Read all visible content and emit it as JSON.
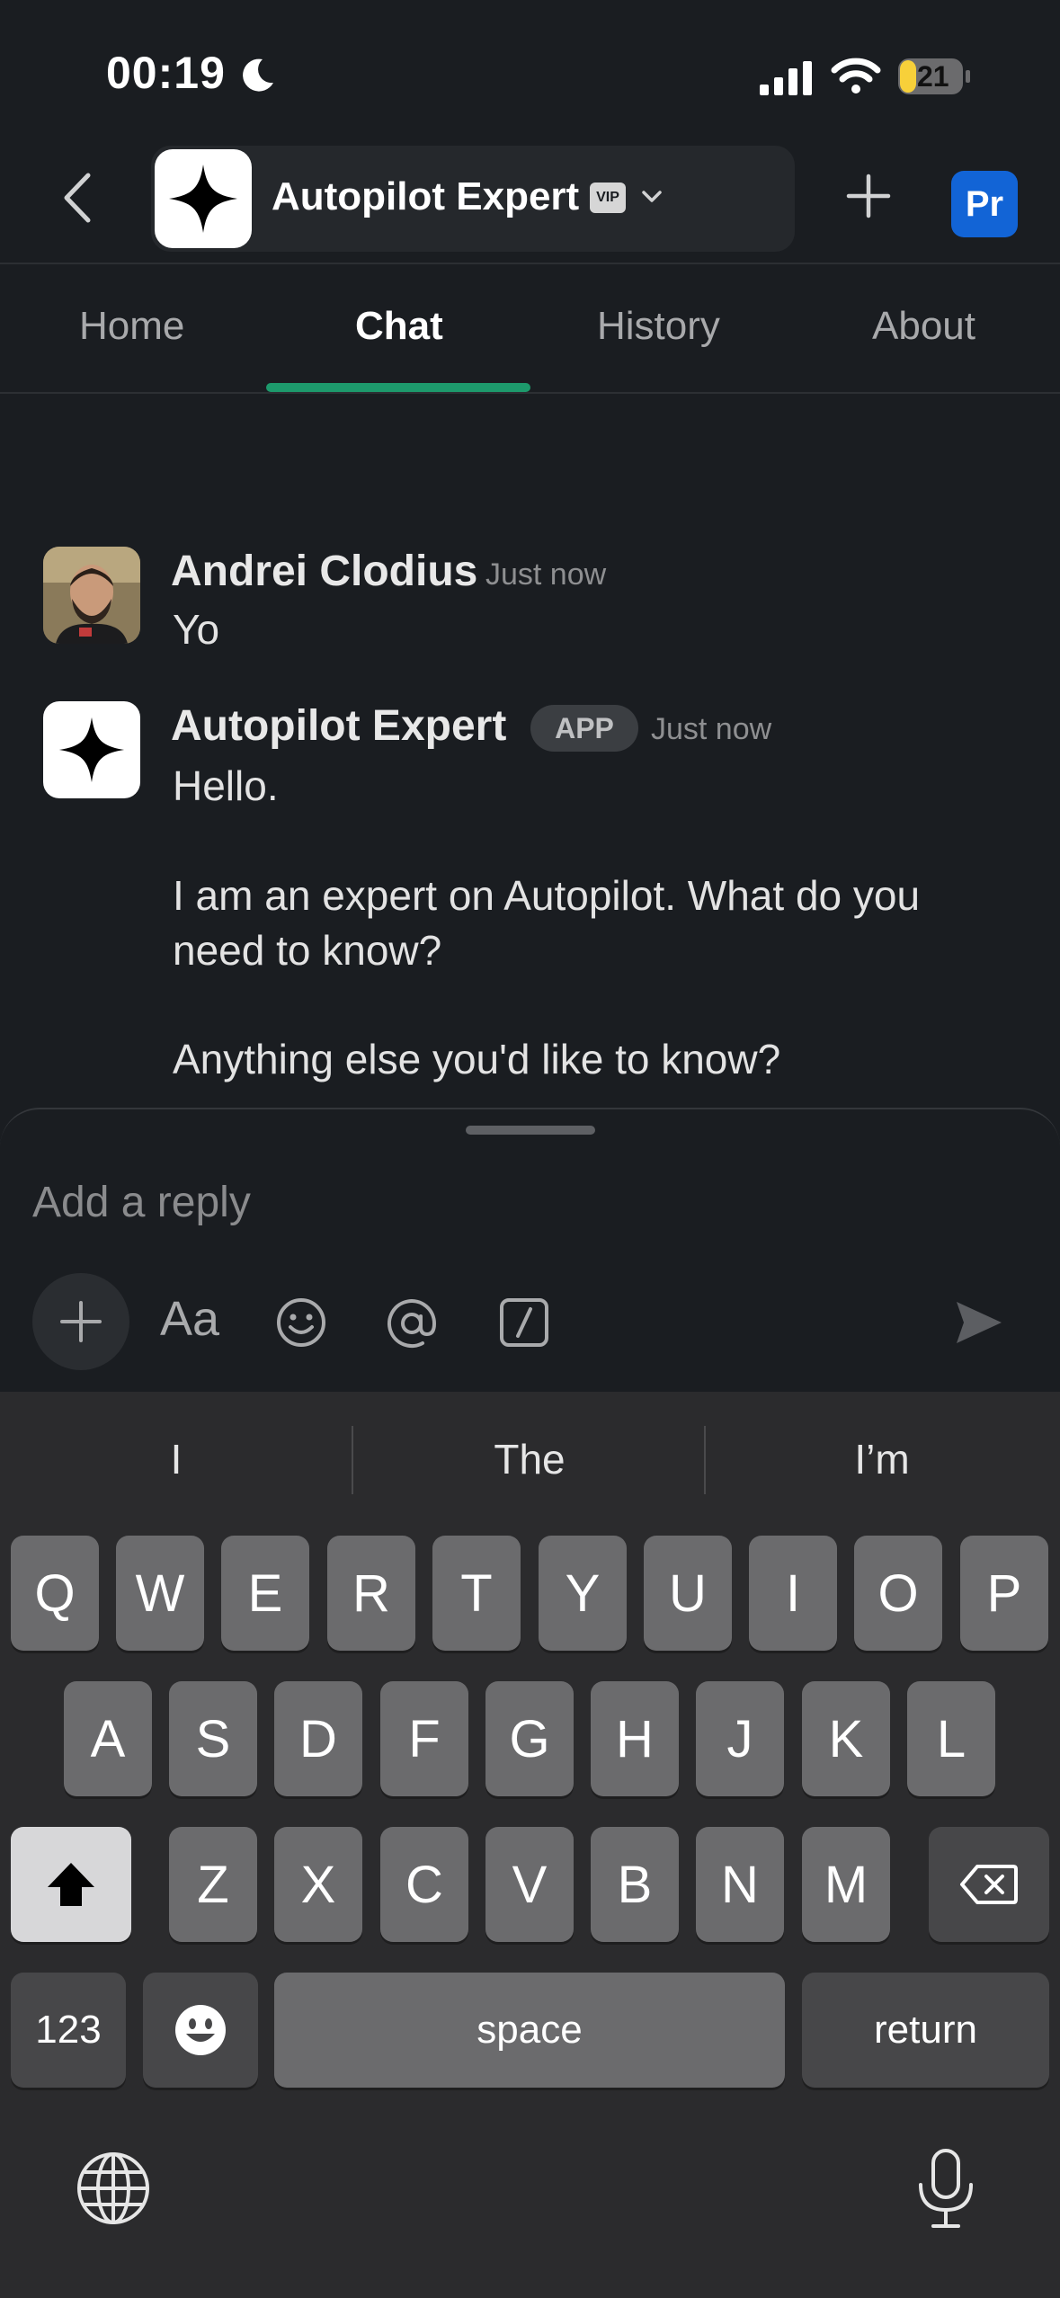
{
  "status_bar": {
    "time": "00:19",
    "battery": "21"
  },
  "header": {
    "channel_name": "Autopilot Expert",
    "vip_badge": "VIP",
    "workspace_initials": "Pr"
  },
  "tabs": [
    {
      "label": "Home"
    },
    {
      "label": "Chat"
    },
    {
      "label": "History"
    },
    {
      "label": "About"
    }
  ],
  "messages": [
    {
      "sender": "Andrei Clodius",
      "time": "Just now",
      "text": "Yo"
    },
    {
      "sender": "Autopilot Expert",
      "badge": "APP",
      "time": "Just now",
      "lines": [
        "Hello.",
        "I am an expert on Autopilot. What do you",
        "need to know?",
        "Anything else you'd like to know?"
      ]
    }
  ],
  "composer": {
    "placeholder": "Add a reply",
    "format_label": "Aa"
  },
  "keyboard": {
    "suggestions": [
      "I",
      "The",
      "I’m"
    ],
    "row1": [
      "Q",
      "W",
      "E",
      "R",
      "T",
      "Y",
      "U",
      "I",
      "O",
      "P"
    ],
    "row2": [
      "A",
      "S",
      "D",
      "F",
      "G",
      "H",
      "J",
      "K",
      "L"
    ],
    "row3": [
      "Z",
      "X",
      "C",
      "V",
      "B",
      "N",
      "M"
    ],
    "numbers_key": "123",
    "space_key": "space",
    "return_key": "return"
  },
  "colors": {
    "background": "#1a1d21",
    "tab_active_underline": "#1d9a6c",
    "workspace_button": "#1264d6",
    "battery_low": "#f7d03a"
  }
}
